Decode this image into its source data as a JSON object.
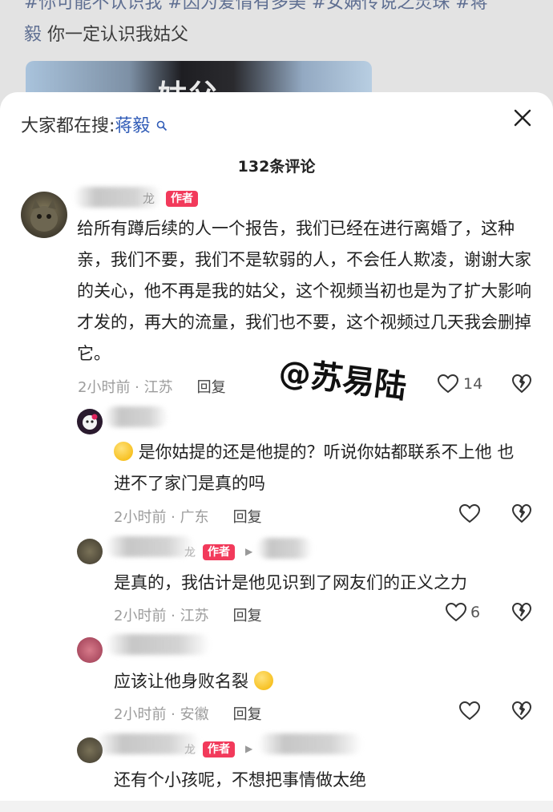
{
  "background": {
    "hashtags_line1_prefix": "#你可能不认识我 #因为爱情有多美 #女娲传说之灵珠 #蒋",
    "hashtags_line2_tag": "毅",
    "hashtags_line2_text": " 你一定认识我姑父",
    "thumb_text": "姑父"
  },
  "search": {
    "label": "大家都在搜:",
    "keyword": "蒋毅"
  },
  "header": {
    "comment_count": "132条评论"
  },
  "badge_author": "作者",
  "watermark": "@苏易陆",
  "comments": [
    {
      "name_suffix": "龙",
      "text": "给所有蹲后续的人一个报告，我们已经在进行离婚了，这种亲，我们不要，我们不是软弱的人，不会任人欺凌，谢谢大家的关心，他不再是我的姑父，这个视频当初也是为了扩大影响才发的，再大的流量，我们也不要，这个视频过几天我会删掉它。",
      "time": "2小时前 · 江苏",
      "reply": "回复",
      "likes": "14"
    },
    {
      "text": "是你姑提的还是他提的？听说你姑都联系不上他 也进不了家门是真的吗",
      "time": "2小时前 · 广东",
      "reply": "回复"
    },
    {
      "name_suffix": "龙",
      "text": "是真的，我估计是他见识到了网友们的正义之力",
      "time": "2小时前 · 江苏",
      "reply": "回复",
      "likes": "6"
    },
    {
      "text": "应该让他身败名裂",
      "time": "2小时前 · 安徽",
      "reply": "回复"
    },
    {
      "name_suffix": "龙",
      "text": "还有个小孩呢，不想把事情做太绝"
    }
  ]
}
